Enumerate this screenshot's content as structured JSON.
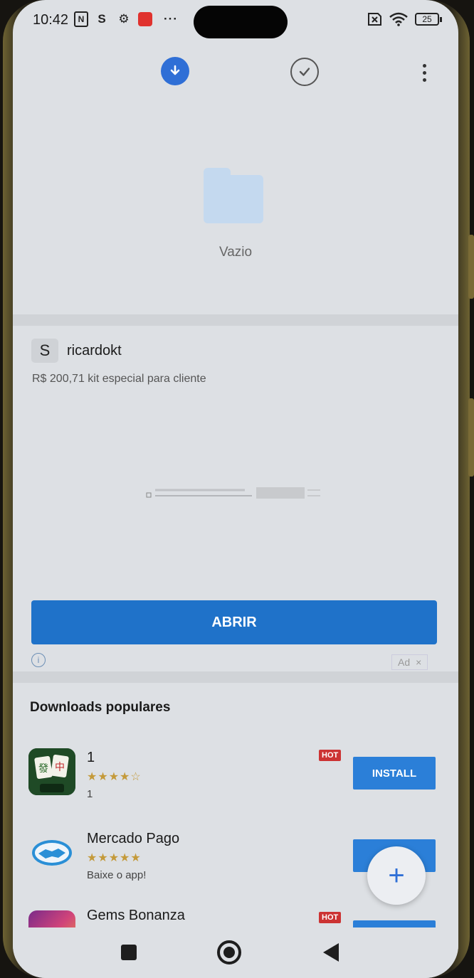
{
  "status_bar": {
    "time": "10:42",
    "battery": "25"
  },
  "toolbar": {
    "download_icon": "download-arrow-icon",
    "check_icon": "check-circle-icon",
    "menu_icon": "more-vertical-icon"
  },
  "empty_state": {
    "label": "Vazio"
  },
  "ad": {
    "logo_letter": "S",
    "advertiser": "ricardokt",
    "description": "R$ 200,71 kit especial para cliente",
    "cta_label": "ABRIR",
    "ad_label": "Ad",
    "close_label": "×",
    "cta_color": "#1f72c9"
  },
  "popular": {
    "title": "Downloads populares",
    "apps": [
      {
        "name": "1",
        "stars": "★★★★☆",
        "subtitle": "1",
        "badge": "HOT",
        "action": "INSTALL"
      },
      {
        "name": "Mercado Pago",
        "stars": "★★★★★",
        "subtitle": "Baixe o app!",
        "badge": "",
        "action": "INSTALL"
      },
      {
        "name": "Gems Bonanza",
        "stars": "",
        "subtitle": "",
        "badge": "HOT",
        "action": ""
      }
    ]
  },
  "fab": {
    "label": "+"
  }
}
